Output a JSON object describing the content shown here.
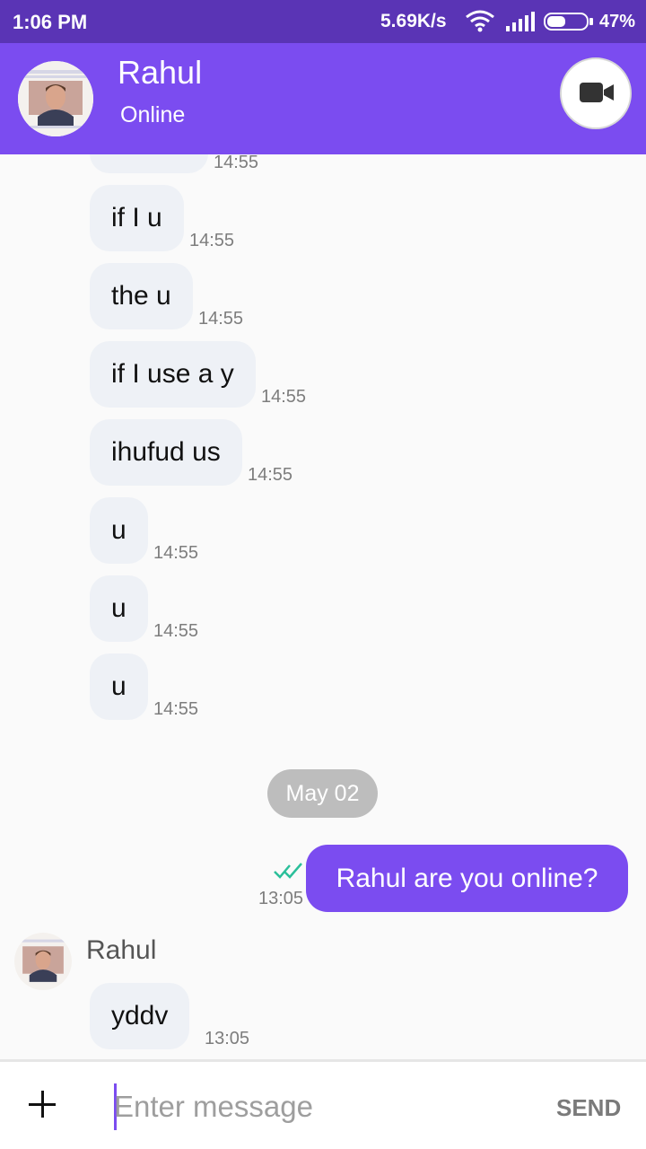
{
  "status_bar": {
    "time": "1:06 PM",
    "network_speed": "5.69K/s",
    "battery": "47%",
    "battery_level": 0.47,
    "icons": [
      "wifi-icon",
      "signal-icon",
      "battery-icon"
    ]
  },
  "header": {
    "contact_name": "Rahul",
    "presence": "Online",
    "video_call_icon": "video-camera-icon"
  },
  "messages": [
    {
      "direction": "in",
      "text": "",
      "time": "14:55"
    },
    {
      "direction": "in",
      "text": "if I u",
      "time": "14:55"
    },
    {
      "direction": "in",
      "text": "the u",
      "time": "14:55"
    },
    {
      "direction": "in",
      "text": "if I use a y",
      "time": "14:55"
    },
    {
      "direction": "in",
      "text": "ihufud us",
      "time": "14:55"
    },
    {
      "direction": "in",
      "text": "u",
      "time": "14:55"
    },
    {
      "direction": "in",
      "text": "u",
      "time": "14:55"
    },
    {
      "direction": "in",
      "text": "u",
      "time": "14:55"
    }
  ],
  "date_separator": "May 02",
  "outgoing": {
    "text": "Rahul are you online?",
    "time": "13:05",
    "status": "read"
  },
  "incoming_group": {
    "sender": "Rahul",
    "text": "yddv",
    "time": "13:05"
  },
  "composer": {
    "placeholder": "Enter message",
    "send_label": "SEND"
  },
  "colors": {
    "status_bar": "#5a34b5",
    "accent": "#7b4cf0",
    "incoming_bubble": "#eef1f6",
    "read_tick": "#2bbf9a"
  }
}
